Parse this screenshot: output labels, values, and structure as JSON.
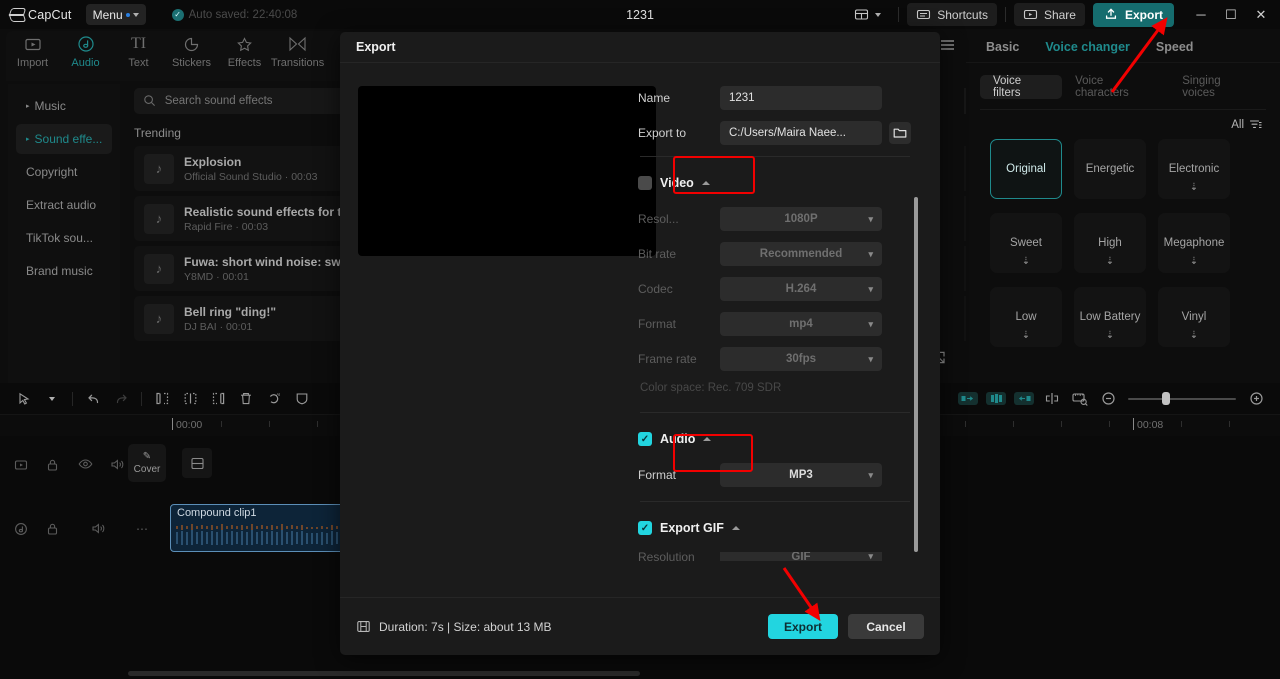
{
  "app": {
    "brand": "CapCut",
    "menu_label": "Menu",
    "autosave_text": "Auto saved: 22:40:08",
    "project_title": "1231",
    "layout_icon": "layout-icon",
    "shortcuts_label": "Shortcuts",
    "share_label": "Share",
    "export_label": "Export",
    "window_minimize": "minimize-icon",
    "window_maximize": "maximize-icon",
    "window_close": "close-icon"
  },
  "nav_tabs": [
    {
      "label": "Import",
      "icon": "import-icon",
      "active": false
    },
    {
      "label": "Audio",
      "icon": "audio-note-icon",
      "active": true
    },
    {
      "label": "Text",
      "icon": "text-icon",
      "active": false
    },
    {
      "label": "Stickers",
      "icon": "sticker-icon",
      "active": false
    },
    {
      "label": "Effects",
      "icon": "sparkle-icon",
      "active": false
    },
    {
      "label": "Transitions",
      "icon": "transition-icon",
      "active": false
    }
  ],
  "categories": [
    {
      "label": "Music",
      "selected": false
    },
    {
      "label": "Sound effe...",
      "selected": true
    },
    {
      "label": "Copyright",
      "selected": false
    },
    {
      "label": "Extract audio",
      "selected": false
    },
    {
      "label": "TikTok sou...",
      "selected": false
    },
    {
      "label": "Brand music",
      "selected": false
    }
  ],
  "search": {
    "placeholder": "Search sound effects",
    "value": ""
  },
  "sounds": {
    "section_title": "Trending",
    "items": [
      {
        "title": "Explosion",
        "meta": "Official Sound Studio · 00:03"
      },
      {
        "title": "Realistic sound effects for ty",
        "meta": "Rapid Fire · 00:03"
      },
      {
        "title": "Fuwa: short wind noise: swip",
        "meta": "Y8MD · 00:01"
      },
      {
        "title": "Bell ring \"ding!\"",
        "meta": "DJ BAI · 00:01"
      }
    ]
  },
  "right_panel": {
    "tabs": [
      {
        "label": "Basic",
        "active": false
      },
      {
        "label": "Voice changer",
        "active": true
      },
      {
        "label": "Speed",
        "active": false
      }
    ],
    "segments": [
      {
        "label": "Voice filters",
        "active": true
      },
      {
        "label": "Voice characters",
        "active": false
      },
      {
        "label": "Singing voices",
        "active": false
      }
    ],
    "filter_label": "All",
    "voices": [
      {
        "label": "Original",
        "selected": true,
        "downloadable": false
      },
      {
        "label": "Energetic",
        "selected": false,
        "downloadable": false
      },
      {
        "label": "Electronic",
        "selected": false,
        "downloadable": true
      },
      {
        "label": "Sweet",
        "selected": false,
        "downloadable": true
      },
      {
        "label": "High",
        "selected": false,
        "downloadable": true
      },
      {
        "label": "Megaphone",
        "selected": false,
        "downloadable": true
      },
      {
        "label": "Low",
        "selected": false,
        "downloadable": true
      },
      {
        "label": "Low Battery",
        "selected": false,
        "downloadable": true
      },
      {
        "label": "Vinyl",
        "selected": false,
        "downloadable": true
      }
    ]
  },
  "timeline": {
    "tools_left": [
      "select-cursor-icon",
      "chevron-down-icon",
      "undo-icon",
      "redo-icon",
      "split-left-icon",
      "split-icon",
      "split-right-icon",
      "delete-icon",
      "mask-ai-icon",
      "shield-icon"
    ],
    "tools_right": [
      "mirror-left-icon",
      "mirror-both-icon",
      "mirror-right-icon",
      "cut-marker-icon",
      "measure-icon",
      "zoom-out-icon",
      "zoom-slider",
      "zoom-in-icon"
    ],
    "ruler_start": "00:00",
    "ruler_end": "00:08",
    "video_track_icons": [
      "video-track-icon",
      "lock-icon",
      "eye-icon",
      "mute-icon",
      "more-icon"
    ],
    "audio_track_icons": [
      "audio-track-icon",
      "lock-icon",
      "mute-icon",
      "more-icon"
    ],
    "cover_label": "Cover",
    "audio_clip_label": "Compound clip1"
  },
  "export_dialog": {
    "title": "Export",
    "name_label": "Name",
    "name_value": "1231",
    "path_label": "Export to",
    "path_value": "C:/Users/Maira Naee...",
    "folder_icon": "folder-icon",
    "video_section": {
      "label": "Video",
      "checked": false,
      "highlighted": true,
      "rows": [
        {
          "label": "Resol...",
          "value": "1080P"
        },
        {
          "label": "Bit rate",
          "value": "Recommended"
        },
        {
          "label": "Codec",
          "value": "H.264"
        },
        {
          "label": "Format",
          "value": "mp4"
        },
        {
          "label": "Frame rate",
          "value": "30fps"
        }
      ],
      "color_space": "Color space: Rec. 709 SDR"
    },
    "audio_section": {
      "label": "Audio",
      "checked": true,
      "highlighted": true,
      "rows": [
        {
          "label": "Format",
          "value": "MP3"
        }
      ]
    },
    "gif_section": {
      "label": "Export GIF",
      "checked": true,
      "rows": [
        {
          "label": "Resolution",
          "value": "GIF"
        }
      ]
    },
    "footer": {
      "duration_text": "Duration: 7s | Size: about 13 MB",
      "export_label": "Export",
      "cancel_label": "Cancel"
    }
  },
  "colors": {
    "accent_teal": "#22d5e0",
    "brand_teal": "#1f8a8c",
    "export_btn_bg": "#156c6e",
    "annotation_red": "#f20000",
    "dialog_bg": "#1b1b1b"
  }
}
